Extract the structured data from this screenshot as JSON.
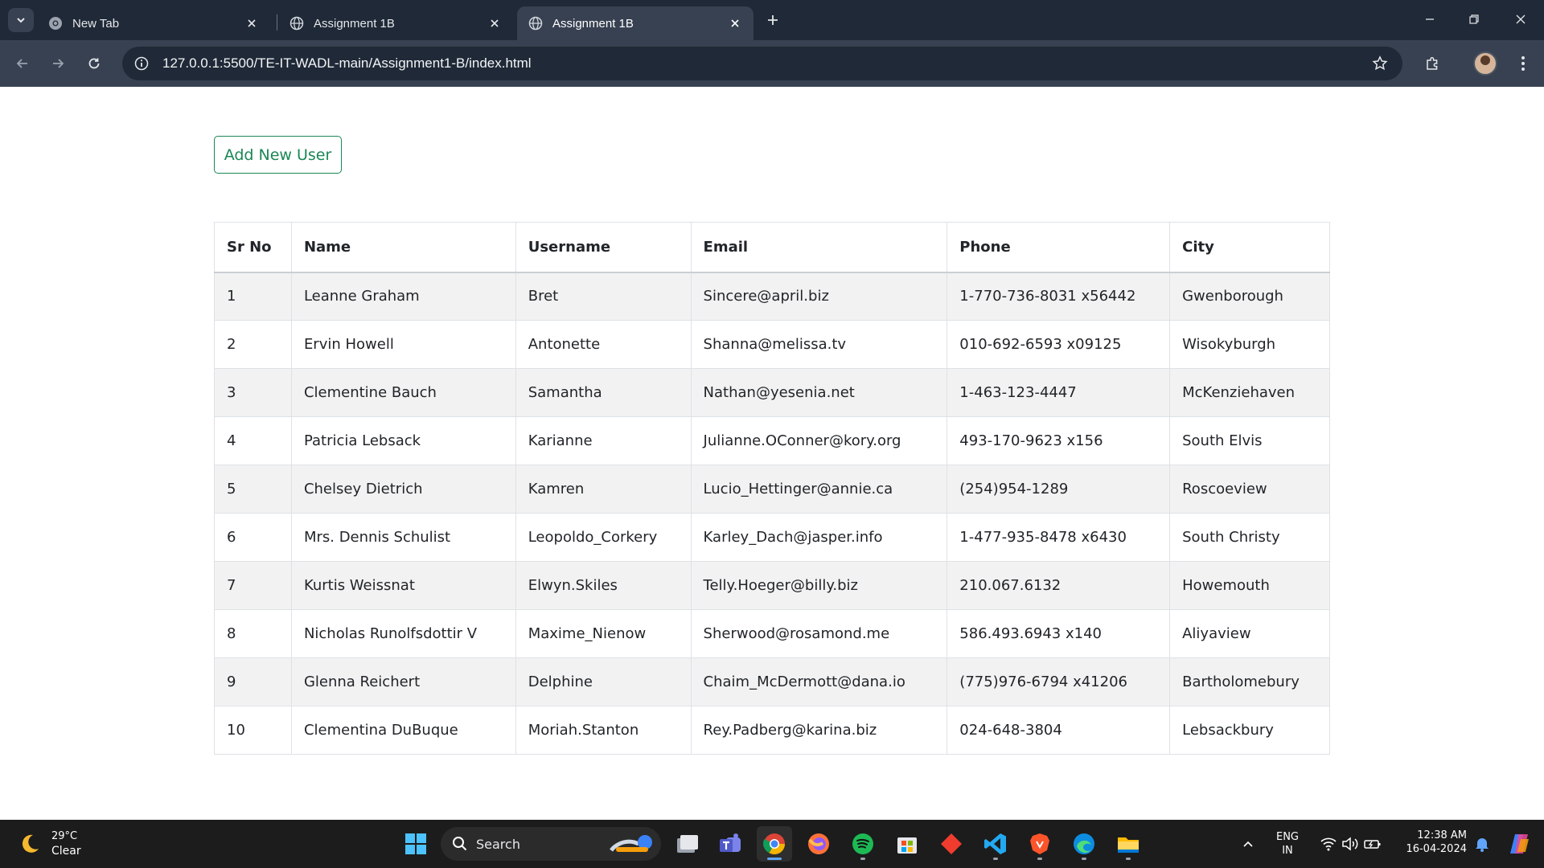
{
  "browser": {
    "tabs": [
      {
        "title": "New Tab",
        "active": false
      },
      {
        "title": "Assignment 1B",
        "active": false
      },
      {
        "title": "Assignment 1B",
        "active": true
      }
    ],
    "url": "127.0.0.1:5500/TE-IT-WADL-main/Assignment1-B/index.html"
  },
  "page": {
    "add_button_label": "Add New User",
    "table": {
      "headers": [
        "Sr No",
        "Name",
        "Username",
        "Email",
        "Phone",
        "City"
      ],
      "rows": [
        [
          "1",
          "Leanne Graham",
          "Bret",
          "Sincere@april.biz",
          "1-770-736-8031 x56442",
          "Gwenborough"
        ],
        [
          "2",
          "Ervin Howell",
          "Antonette",
          "Shanna@melissa.tv",
          "010-692-6593 x09125",
          "Wisokyburgh"
        ],
        [
          "3",
          "Clementine Bauch",
          "Samantha",
          "Nathan@yesenia.net",
          "1-463-123-4447",
          "McKenziehaven"
        ],
        [
          "4",
          "Patricia Lebsack",
          "Karianne",
          "Julianne.OConner@kory.org",
          "493-170-9623 x156",
          "South Elvis"
        ],
        [
          "5",
          "Chelsey Dietrich",
          "Kamren",
          "Lucio_Hettinger@annie.ca",
          "(254)954-1289",
          "Roscoeview"
        ],
        [
          "6",
          "Mrs. Dennis Schulist",
          "Leopoldo_Corkery",
          "Karley_Dach@jasper.info",
          "1-477-935-8478 x6430",
          "South Christy"
        ],
        [
          "7",
          "Kurtis Weissnat",
          "Elwyn.Skiles",
          "Telly.Hoeger@billy.biz",
          "210.067.6132",
          "Howemouth"
        ],
        [
          "8",
          "Nicholas Runolfsdottir V",
          "Maxime_Nienow",
          "Sherwood@rosamond.me",
          "586.493.6943 x140",
          "Aliyaview"
        ],
        [
          "9",
          "Glenna Reichert",
          "Delphine",
          "Chaim_McDermott@dana.io",
          "(775)976-6794 x41206",
          "Bartholomebury"
        ],
        [
          "10",
          "Clementina DuBuque",
          "Moriah.Stanton",
          "Rey.Padberg@karina.biz",
          "024-648-3804",
          "Lebsackbury"
        ]
      ]
    }
  },
  "taskbar": {
    "weather_temp": "29°C",
    "weather_condition": "Clear",
    "search_label": "Search",
    "language_line1": "ENG",
    "language_line2": "IN",
    "time": "12:38 AM",
    "date": "16-04-2024",
    "icons": [
      "start-icon",
      "search-icon",
      "task-view-icon",
      "teams-icon",
      "chrome-icon",
      "firefox-icon",
      "spotify-icon",
      "store-icon",
      "git-icon",
      "vscode-icon",
      "brave-icon",
      "edge-icon",
      "file-explorer-icon"
    ]
  },
  "colors": {
    "accent_green": "#198754",
    "chrome_dark": "#1f2937",
    "chrome_toolbar": "#374151",
    "taskbar": "#1c1c1c"
  }
}
